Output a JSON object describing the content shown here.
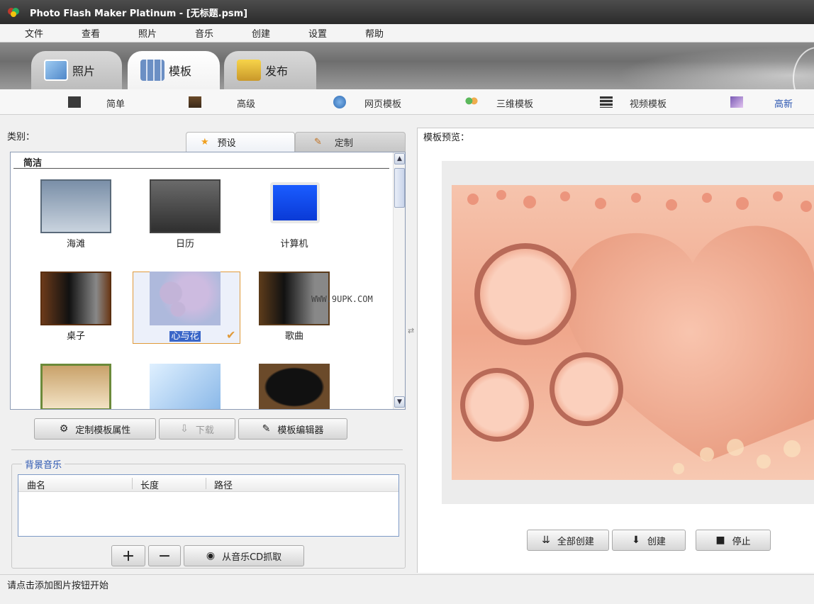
{
  "window": {
    "title": "Photo Flash Maker Platinum - [无标题.psm]"
  },
  "menu": [
    "文件",
    "查看",
    "照片",
    "音乐",
    "创建",
    "设置",
    "帮助"
  ],
  "main_tabs": [
    {
      "label": "照片",
      "icon": "photo-icon"
    },
    {
      "label": "模板",
      "icon": "template-icon",
      "active": true
    },
    {
      "label": "发布",
      "icon": "publish-icon"
    }
  ],
  "sub_tabs": [
    {
      "label": "简单",
      "icon": "simple-icon"
    },
    {
      "label": "高级",
      "icon": "advanced-icon"
    },
    {
      "label": "网页模板",
      "icon": "web-template-icon"
    },
    {
      "label": "三维模板",
      "icon": "3d-template-icon"
    },
    {
      "label": "视频模板",
      "icon": "video-template-icon"
    },
    {
      "label": "高新",
      "icon": "hd-icon",
      "active": true
    }
  ],
  "left": {
    "category_label": "类别：",
    "tabs": {
      "preset": "预设",
      "custom": "定制"
    },
    "group_title": "简洁",
    "templates": [
      {
        "label": "海滩"
      },
      {
        "label": "日历"
      },
      {
        "label": "计算机"
      },
      {
        "label": "桌子"
      },
      {
        "label": "心与花",
        "selected": true
      },
      {
        "label": "歌曲"
      },
      {
        "label": ""
      },
      {
        "label": ""
      },
      {
        "label": ""
      }
    ],
    "watermark": "WWW.9UPK.COM",
    "buttons": {
      "customize": "定制模板属性",
      "download": "下载",
      "editor": "模板编辑器"
    },
    "music": {
      "legend": "背景音乐",
      "columns": [
        "曲名",
        "长度",
        "路径"
      ],
      "rip_button": "从音乐CD抓取"
    }
  },
  "right": {
    "preview_label": "模板预览：",
    "buttons": {
      "create_all": "全部创建",
      "create": "创建",
      "stop": "停止"
    }
  },
  "status": {
    "text": "请点击添加图片按钮开始"
  },
  "colors": {
    "accent": "#2a55b0",
    "selection": "#3a66c8",
    "preview_bg": "#f4b7a0"
  }
}
